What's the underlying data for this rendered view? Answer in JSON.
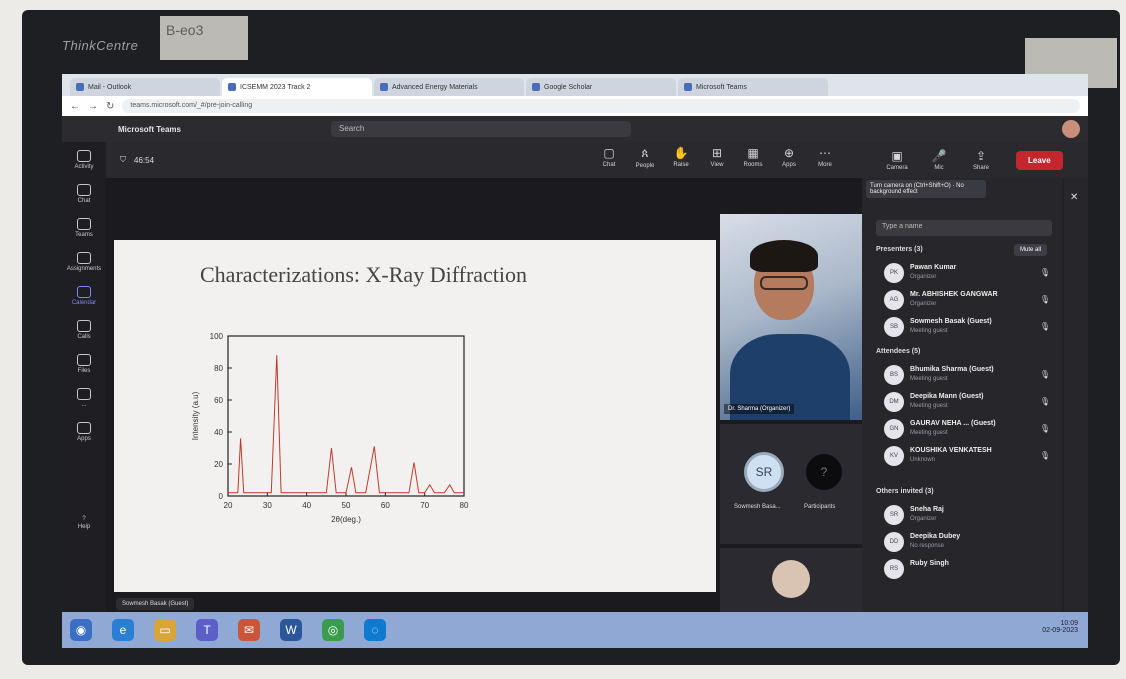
{
  "bezel": {
    "brand": "ThinkCentre",
    "sticky_left": "B-eo3"
  },
  "browser": {
    "tabs": [
      {
        "label": "Mail - Outlook",
        "active": false
      },
      {
        "label": "ICSEMM 2023 Track 2",
        "active": true
      },
      {
        "label": "Advanced Energy Materials",
        "active": false
      },
      {
        "label": "Google Scholar",
        "active": false
      },
      {
        "label": "Microsoft Teams",
        "active": false
      }
    ],
    "url": "teams.microsoft.com/_#/pre-join-calling"
  },
  "teams": {
    "app_name": "Microsoft Teams",
    "search_placeholder": "Search",
    "rail": [
      {
        "label": "Activity",
        "icon": "bell-icon"
      },
      {
        "label": "Chat",
        "icon": "chat-icon"
      },
      {
        "label": "Teams",
        "icon": "teams-icon"
      },
      {
        "label": "Assignments",
        "icon": "assignments-icon"
      },
      {
        "label": "Calendar",
        "icon": "calendar-icon"
      },
      {
        "label": "Calls",
        "icon": "phone-icon"
      },
      {
        "label": "Files",
        "icon": "files-icon"
      },
      {
        "label": "...",
        "icon": "more-icon"
      },
      {
        "label": "Apps",
        "icon": "apps-icon"
      }
    ],
    "help_label": "Help",
    "meeting_timer": "46:54",
    "toolbar": [
      {
        "label": "Chat",
        "glyph": "▢"
      },
      {
        "label": "People",
        "glyph": "ጰ"
      },
      {
        "label": "Raise",
        "glyph": "✋"
      },
      {
        "label": "View",
        "glyph": "⊞"
      },
      {
        "label": "Rooms",
        "glyph": "▦"
      },
      {
        "label": "Apps",
        "glyph": "⊕"
      },
      {
        "label": "More",
        "glyph": "⋯"
      }
    ],
    "controls": [
      {
        "label": "Camera",
        "glyph": "▣"
      },
      {
        "label": "Mic",
        "glyph": "🎤"
      },
      {
        "label": "Share",
        "glyph": "⇪"
      }
    ],
    "leave_label": "Leave"
  },
  "slide": {
    "title": "Characterizations: X-Ray Diffraction",
    "presenter_tag": "Sowmesh Basak (Guest)"
  },
  "chart_data": {
    "type": "line",
    "title": "",
    "xlabel": "2θ(deg.)",
    "ylabel": "Intensity (a.u)",
    "xlim": [
      20,
      80
    ],
    "ylim": [
      0,
      100
    ],
    "xticks": [
      20,
      30,
      40,
      50,
      60,
      70,
      80
    ],
    "yticks": [
      0,
      20,
      40,
      60,
      80,
      100
    ],
    "x": [
      20,
      22.5,
      23.2,
      24,
      27,
      31,
      32.4,
      33.5,
      36,
      40,
      45,
      46.3,
      47.5,
      50,
      51.4,
      52.5,
      55,
      57.2,
      58.5,
      62,
      66,
      67.3,
      68.5,
      70,
      71.3,
      72.5,
      75,
      76.4,
      77.5,
      80
    ],
    "y": [
      2,
      2,
      36,
      2,
      2,
      2,
      88,
      2,
      2,
      2,
      2,
      30,
      2,
      2,
      18,
      2,
      2,
      31,
      2,
      2,
      2,
      21,
      2,
      2,
      7,
      2,
      2,
      7,
      2,
      2
    ],
    "colors": {
      "line": "#c0392b",
      "frame": "#222222"
    },
    "grid": false
  },
  "videos": {
    "main_name": "Dr. Sharma (Organizer)",
    "tile1": {
      "initials": "SR",
      "name": "Sowmesh Basa..."
    },
    "tile2": {
      "name": "Participants",
      "initials": "?"
    }
  },
  "panel": {
    "tooltip": "Turn camera on (Ctrl+Shift+O) · No background effect",
    "search_placeholder": "Type a name",
    "presenters_header": "Presenters (3)",
    "mute_all": "Mute all",
    "presenters": [
      {
        "name": "Pawan Kumar",
        "role": "Organizer",
        "initials": "PK"
      },
      {
        "name": "Mr. ABHISHEK GANGWAR",
        "role": "Organizer",
        "initials": "AG"
      },
      {
        "name": "Sowmesh Basak (Guest)",
        "role": "Meeting guest",
        "initials": "SB"
      }
    ],
    "attendees_header": "Attendees (5)",
    "attendees": [
      {
        "name": "Bhumika Sharma (Guest)",
        "role": "Meeting guest",
        "initials": "BS"
      },
      {
        "name": "Deepika Mann (Guest)",
        "role": "Meeting guest",
        "initials": "DM"
      },
      {
        "name": "GAURAV NEHA ... (Guest)",
        "role": "Meeting guest",
        "initials": "GN"
      },
      {
        "name": "KOUSHIKA VENKATESH",
        "role": "Unknown",
        "initials": "KV"
      }
    ],
    "others_header": "Others invited (3)",
    "others": [
      {
        "name": "Sneha Raj",
        "role": "Organizer",
        "initials": "SR"
      },
      {
        "name": "Deepika Dubey",
        "role": "No response",
        "initials": "DD"
      },
      {
        "name": "Ruby Singh",
        "role": "",
        "initials": "RS"
      }
    ]
  },
  "taskbar": {
    "apps": [
      {
        "icon": "start-icon",
        "glyph": "◉",
        "color": "#3a6fc4"
      },
      {
        "icon": "ie-icon",
        "glyph": "e",
        "color": "#2a7fd4"
      },
      {
        "icon": "explorer-icon",
        "glyph": "▭",
        "color": "#d9a43a"
      },
      {
        "icon": "teams-taskbar-icon",
        "glyph": "T",
        "color": "#5b5fc7"
      },
      {
        "icon": "mail-icon",
        "glyph": "✉",
        "color": "#c9553a"
      },
      {
        "icon": "word-icon",
        "glyph": "W",
        "color": "#2b579a"
      },
      {
        "icon": "chrome-icon",
        "glyph": "◎",
        "color": "#3b9c4e"
      },
      {
        "icon": "edge-icon",
        "glyph": "◌",
        "color": "#0f7bd0"
      }
    ],
    "time": "10:09",
    "date": "02-09-2023"
  }
}
